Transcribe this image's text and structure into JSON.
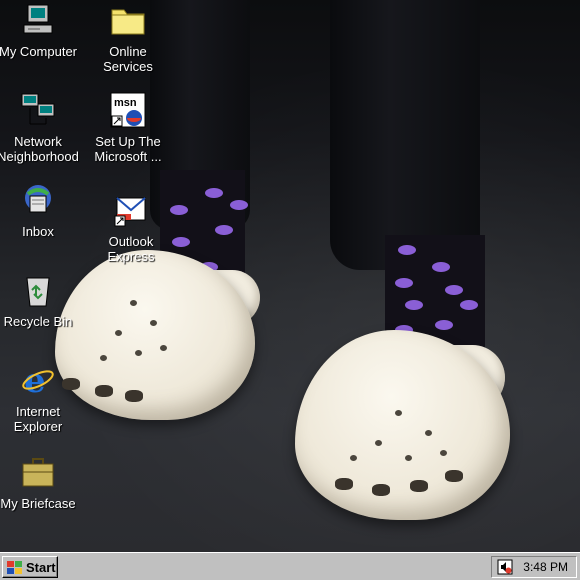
{
  "desktop": {
    "icons": [
      {
        "label": "My Computer",
        "icon": "my-computer-icon"
      },
      {
        "label": "Online Services",
        "icon": "folder-icon"
      },
      {
        "label": "Network Neighborhood",
        "icon": "network-neighborhood-icon"
      },
      {
        "label": "Set Up The Microsoft ...",
        "icon": "msn-setup-icon"
      },
      {
        "label": "Inbox",
        "icon": "inbox-icon"
      },
      {
        "label": "Outlook Express",
        "icon": "outlook-express-icon"
      },
      {
        "label": "Recycle Bin",
        "icon": "recycle-bin-icon"
      },
      {
        "label": "Internet Explorer",
        "icon": "internet-explorer-icon"
      },
      {
        "label": "My Briefcase",
        "icon": "briefcase-icon"
      }
    ],
    "wallpaper": "photo of feet in white clogs and purple polka-dot socks on asphalt"
  },
  "taskbar": {
    "start_label": "Start",
    "clock": "3:48 PM",
    "tray_icons": [
      "volume-icon"
    ]
  },
  "colors": {
    "taskbar": "#c0c0c0",
    "icon_label": "#ffffff",
    "sock_dots": "#8a5fd6"
  }
}
